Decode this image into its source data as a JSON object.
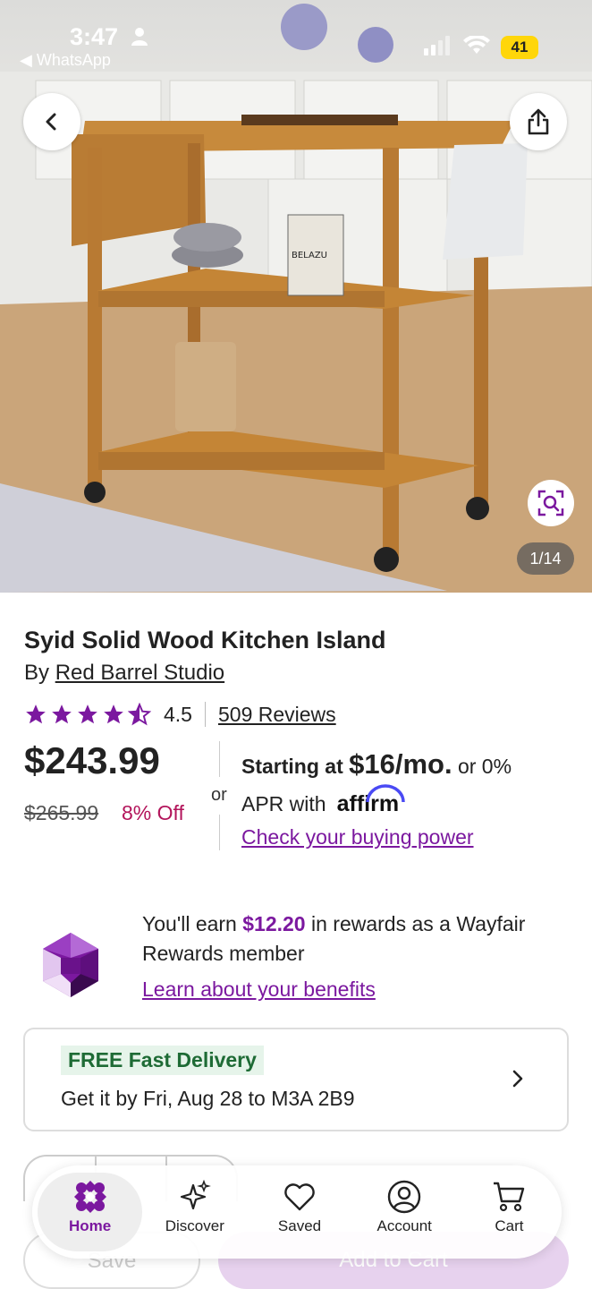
{
  "status_bar": {
    "time": "3:47",
    "back_app": "WhatsApp",
    "battery": "41"
  },
  "hero": {
    "image_counter": "1/14",
    "box_label": "BELAZU"
  },
  "product": {
    "title": "Syid Solid Wood Kitchen Island",
    "brand_prefix": "By ",
    "brand": "Red Barrel Studio",
    "rating": "4.5",
    "rating_fraction": 0.9,
    "reviews": "509 Reviews",
    "price": "$243.99",
    "old_price": "$265.99",
    "discount": "8% Off"
  },
  "financing": {
    "or": "or",
    "starting": "Starting at ",
    "monthly": "$16/mo.",
    "or_zero": " or 0%",
    "apr_with": "APR with",
    "affirm": "affirm",
    "buying_power": "Check your buying power"
  },
  "rewards": {
    "earn_prefix": "You'll earn ",
    "amount": "$12.20",
    "earn_suffix": " in rewards as a Wayfair Rewards member",
    "benefits": "Learn about your benefits"
  },
  "delivery": {
    "badge": "FREE Fast Delivery",
    "date": "Get it by Fri, Aug 28 to M3A 2B9"
  },
  "actions": {
    "save": "Save",
    "add_to_cart": "Add to Cart"
  },
  "tabs": [
    {
      "label": "Home",
      "icon": "home-icon"
    },
    {
      "label": "Discover",
      "icon": "sparkle-icon"
    },
    {
      "label": "Saved",
      "icon": "heart-icon"
    },
    {
      "label": "Account",
      "icon": "account-icon"
    },
    {
      "label": "Cart",
      "icon": "cart-icon"
    }
  ],
  "colors": {
    "accent": "#7b189f",
    "discount": "#b3155b",
    "delivery_green": "#1e6b35"
  }
}
